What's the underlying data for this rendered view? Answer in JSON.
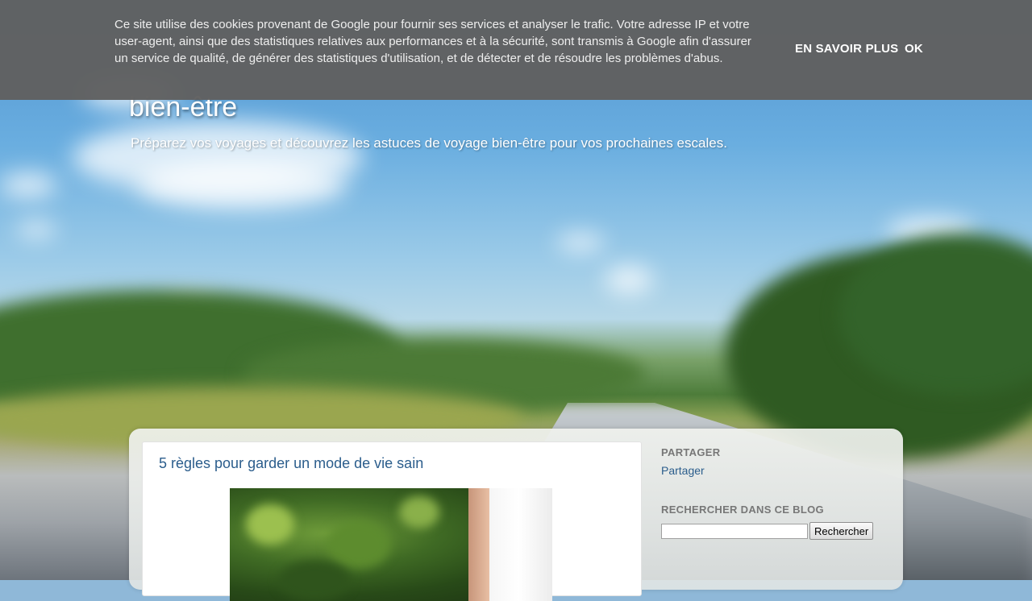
{
  "cookie_banner": {
    "text": "Ce site utilise des cookies provenant de Google pour fournir ses services et analyser le trafic. Votre adresse IP et votre user-agent, ainsi que des statistiques relatives aux performances et à la sécurité, sont transmis à Google afin d'assurer un service de qualité, de générer des statistiques d'utilisation, et de détecter et de résoudre les problèmes d'abus.",
    "learn_more_label": "EN SAVOIR PLUS",
    "ok_label": "OK"
  },
  "header": {
    "title": "bien-être",
    "description": "Préparez vos voyages et découvrez les astuces de voyage bien-être pour vos prochaines escales."
  },
  "post": {
    "title": "5 règles pour garder un mode de vie sain"
  },
  "sidebar": {
    "share": {
      "title": "PARTAGER",
      "link": "Partager"
    },
    "search": {
      "title": "RECHERCHER DANS CE BLOG",
      "input_value": "",
      "button_label": "Rechercher"
    }
  },
  "colors": {
    "link": "#2b5d8c",
    "cookie_bg": "#606060",
    "widget_title": "#777777"
  }
}
